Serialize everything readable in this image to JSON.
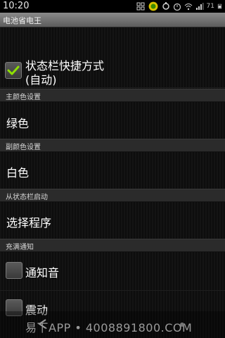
{
  "status_bar": {
    "time": "10:20",
    "battery_text": "71"
  },
  "title_bar": {
    "title": "电池省电王"
  },
  "preferences": {
    "shortcut": {
      "label_line1": "状态栏快捷方式",
      "label_line2": "(自动)",
      "checked": true
    },
    "primary_color_header": "主颜色设置",
    "primary_color_value": "绿色",
    "secondary_color_header": "副颜色设置",
    "secondary_color_value": "白色",
    "launch_header": "从状态栏启动",
    "launch_value": "选择程序",
    "full_notify_header": "充满通知",
    "notify_sound": {
      "label": "通知音",
      "checked": false
    },
    "vibrate": {
      "label": "震动",
      "checked": false
    }
  },
  "watermark": {
    "text": "易下APP • 4008891800.COM"
  },
  "colors": {
    "check_green": "#8ee000",
    "section_bg": "#2b2b2b",
    "titlebar_top": "#8a8a8a"
  }
}
